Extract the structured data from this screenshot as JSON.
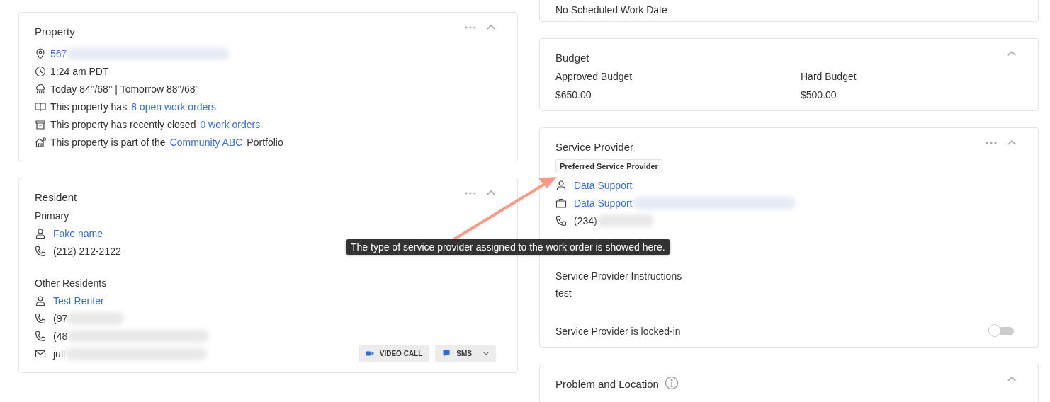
{
  "property": {
    "title": "Property",
    "has_menu": true,
    "expanded": true,
    "rows": [
      {
        "kind": "address",
        "link": "567"
      },
      {
        "kind": "time",
        "text": "1:24 am PDT"
      },
      {
        "kind": "weather",
        "text": "Today 84°/68° | Tomorrow 88°/68°"
      },
      {
        "kind": "open",
        "text": "This property has",
        "link": "8 open work orders"
      },
      {
        "kind": "closed",
        "text": "This property has recently closed",
        "link": "0 work orders"
      },
      {
        "kind": "portfolio",
        "text": "This property is part of the",
        "link": "Community ABC",
        "suffix": "Portfolio"
      }
    ]
  },
  "resident": {
    "title": "Resident",
    "has_menu": true,
    "expanded": true,
    "primary": {
      "label": "Primary",
      "name": "Fake name",
      "phone": "(212) 212-2122"
    },
    "others": {
      "label": "Other Residents",
      "name": "Test Renter",
      "phones": [
        "(97",
        "(48"
      ],
      "email": "jull"
    },
    "buttons": [
      {
        "kind": "video",
        "label": "VIDEO CALL"
      },
      {
        "kind": "sms",
        "label": "SMS"
      }
    ]
  },
  "schedule": {
    "text": "No Scheduled Work Date"
  },
  "budget": {
    "title": "Budget",
    "has_menu": false,
    "expanded": true,
    "items": [
      {
        "label": "Approved Budget",
        "value": "$650.00"
      },
      {
        "label": "Hard Budget",
        "value": "$500.00"
      }
    ]
  },
  "service_provider": {
    "title": "Service Provider",
    "has_menu": true,
    "expanded": true,
    "tag": "Preferred Service Provider",
    "contact": "Data Support",
    "company": "Data Support",
    "phone": "(234)",
    "instructions_label": "Service Provider Instructions",
    "instructions": "test",
    "locked_label": "Service Provider is locked-in",
    "locked_in": false
  },
  "problem": {
    "title": "Problem and Location",
    "has_menu": false,
    "expanded": true
  },
  "tooltip": {
    "text": "The type of service provider assigned to the work order is showed here."
  }
}
